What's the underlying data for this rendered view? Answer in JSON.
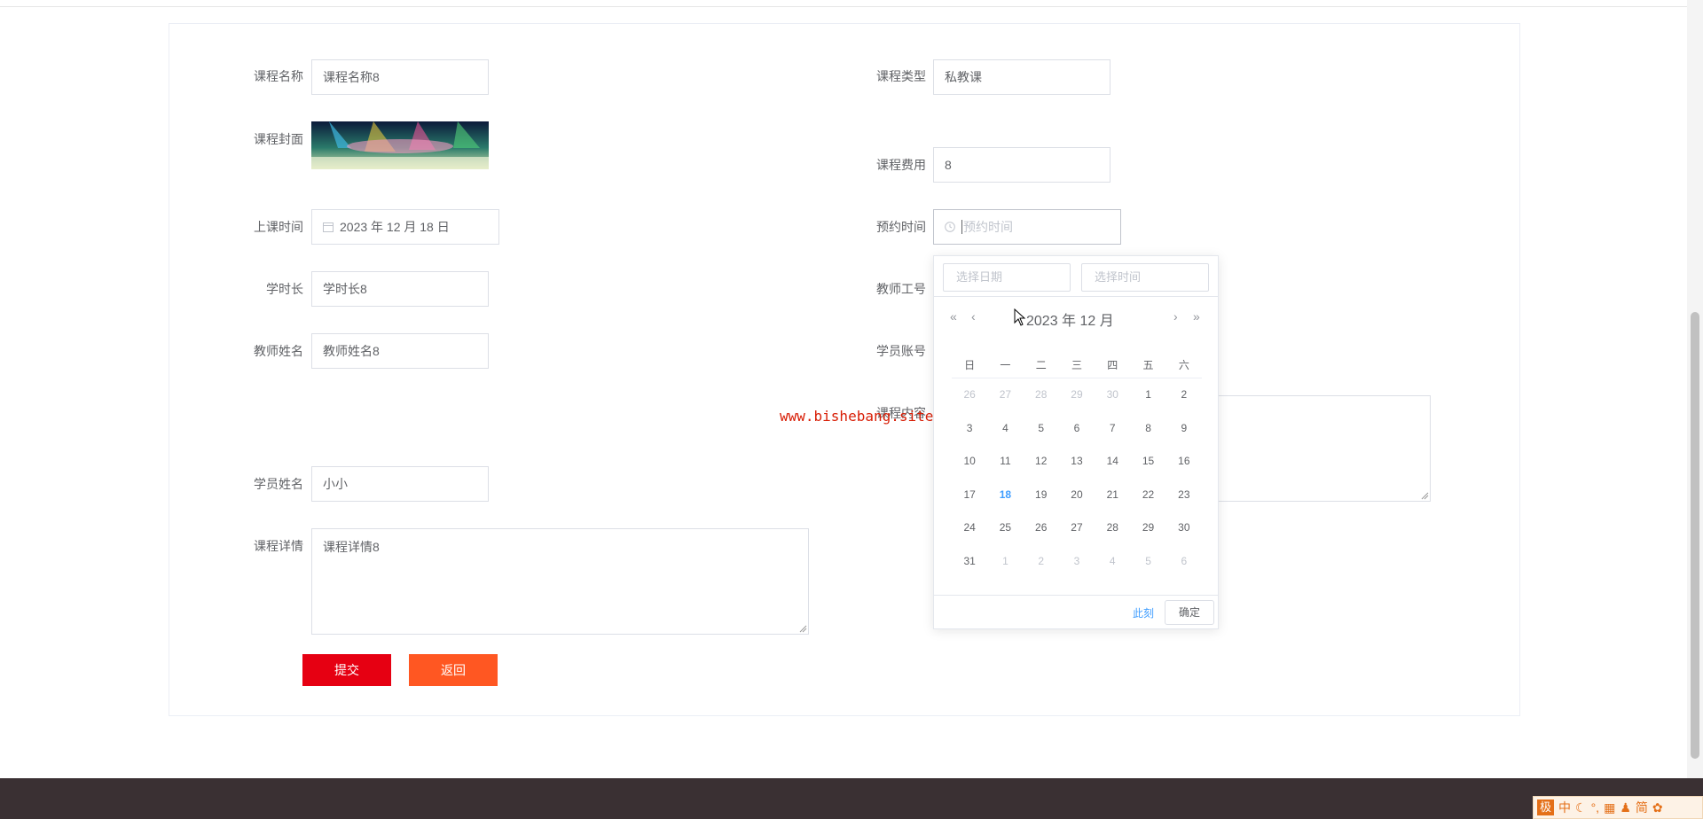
{
  "form": {
    "course_name_label": "课程名称",
    "course_name_value": "课程名称8",
    "course_type_label": "课程类型",
    "course_type_value": "私教课",
    "cover_label": "课程封面",
    "fee_label": "课程费用",
    "fee_value": "8",
    "class_time_label": "上课时间",
    "class_time_value": "2023 年 12 月 18 日",
    "booking_time_label": "预约时间",
    "booking_time_placeholder": "预约时间",
    "duration_label": "学时长",
    "duration_value": "学时长8",
    "teacher_id_label": "教师工号",
    "teacher_name_label": "教师姓名",
    "teacher_name_value": "教师姓名8",
    "student_account_label": "学员账号",
    "course_content_label": "课程内容",
    "student_name_label": "学员姓名",
    "student_name_value": "小小",
    "details_label": "课程详情",
    "details_value": "课程详情8",
    "submit_label": "提交",
    "back_label": "返回"
  },
  "picker": {
    "date_placeholder": "选择日期",
    "time_placeholder": "选择时间",
    "year_month": "2023 年  12 月",
    "prev_year": "«",
    "prev_month": "‹",
    "next_month": "›",
    "next_year": "»",
    "weekdays": [
      "日",
      "一",
      "二",
      "三",
      "四",
      "五",
      "六"
    ],
    "weeks": [
      [
        "26",
        "27",
        "28",
        "29",
        "30",
        "1",
        "2"
      ],
      [
        "3",
        "4",
        "5",
        "6",
        "7",
        "8",
        "9"
      ],
      [
        "10",
        "11",
        "12",
        "13",
        "14",
        "15",
        "16"
      ],
      [
        "17",
        "18",
        "19",
        "20",
        "21",
        "22",
        "23"
      ],
      [
        "24",
        "25",
        "26",
        "27",
        "28",
        "29",
        "30"
      ],
      [
        "31",
        "1",
        "2",
        "3",
        "4",
        "5",
        "6"
      ]
    ],
    "today": "18",
    "now_label": "此刻",
    "confirm_label": "确定"
  },
  "watermark": "www.bishebang.site",
  "tray": {
    "items": [
      "极",
      "中",
      "☾",
      "°,",
      "▦",
      "♟",
      "简",
      "✿"
    ]
  },
  "colors": {
    "submit": "#e60012",
    "back": "#ff5722",
    "link": "#409eff",
    "footer": "#3a3033"
  }
}
